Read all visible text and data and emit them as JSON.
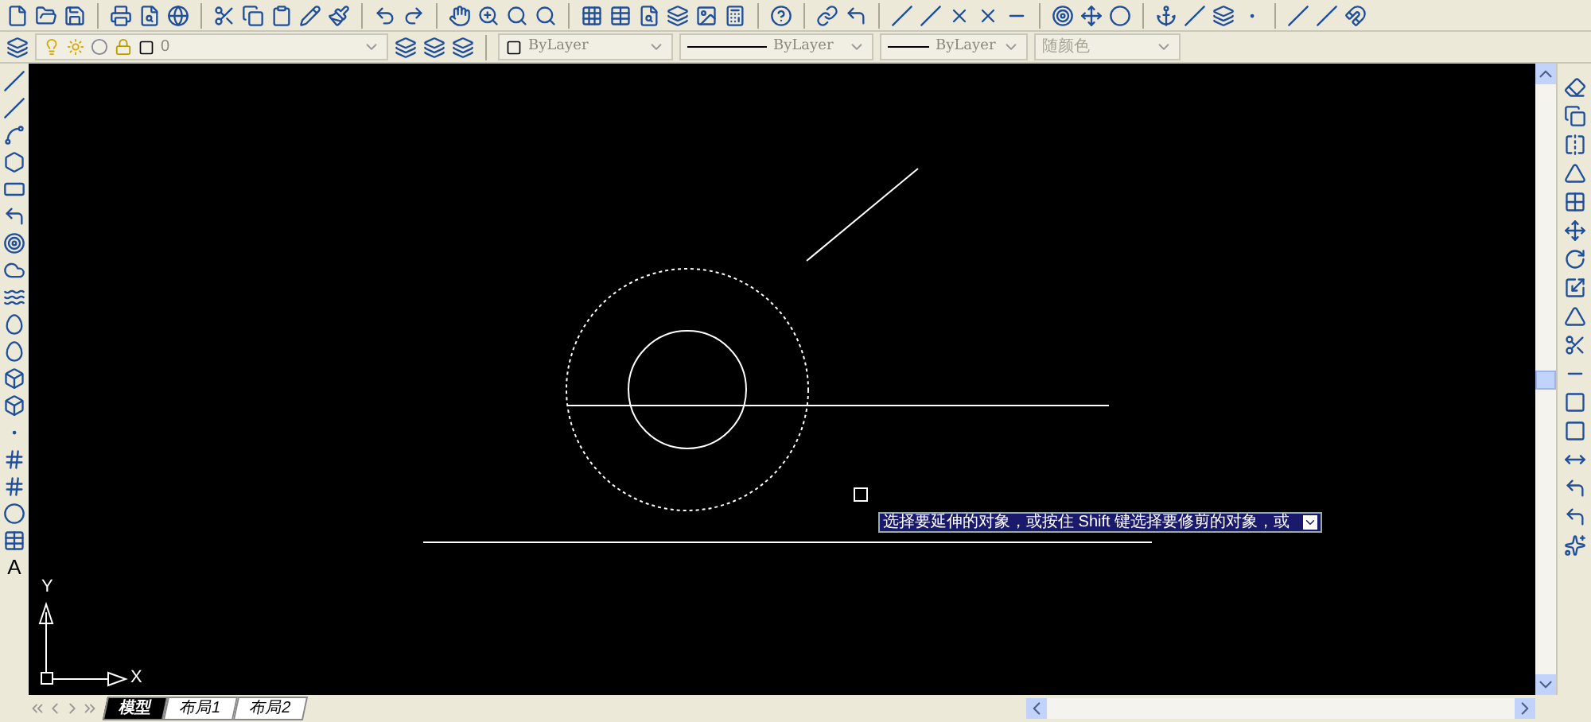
{
  "properties_bar": {
    "layer": {
      "value": "0"
    },
    "color": {
      "value": "ByLayer"
    },
    "linetype": {
      "value": "ByLayer"
    },
    "lineweight": {
      "value": "ByLayer"
    },
    "plot_style": {
      "value": "随颜色",
      "disabled": true
    }
  },
  "draw_toolbar": {
    "text_tool_label": "A"
  },
  "canvas": {
    "tooltip": "选择要延伸的对象，或按住 Shift 键选择要修剪的对象，或",
    "ucs": {
      "x_label": "X",
      "y_label": "Y"
    }
  },
  "layout_tabs": [
    {
      "label": "模型",
      "selected": true
    },
    {
      "label": "布局1",
      "selected": false
    },
    {
      "label": "布局2",
      "selected": false
    }
  ]
}
